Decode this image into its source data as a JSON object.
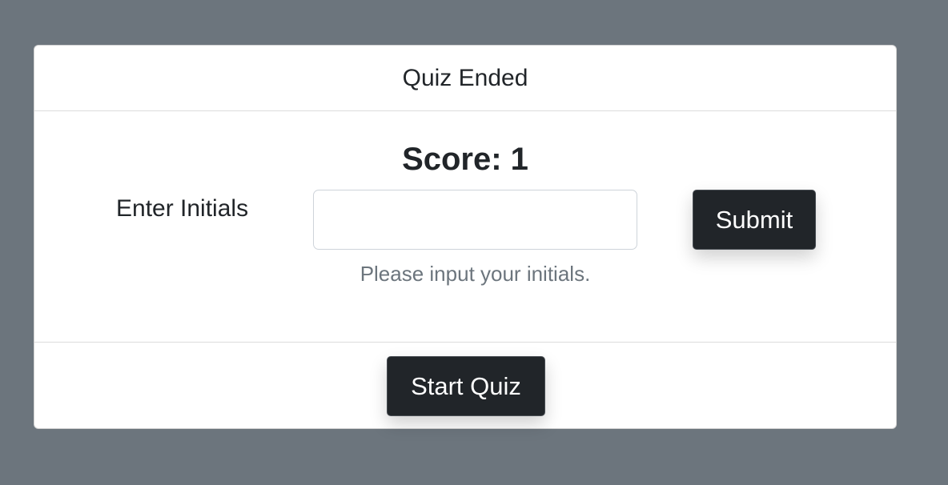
{
  "card": {
    "header_title": "Quiz Ended",
    "score_text": "Score: 1",
    "initials_label": "Enter Initials",
    "initials_input_value": "",
    "initials_input_placeholder": "",
    "help_text": "Please input your initials.",
    "submit_label": "Submit",
    "start_label": "Start Quiz"
  },
  "colors": {
    "background": "#6c757d",
    "card": "#ffffff",
    "button_dark": "#212529",
    "muted_text": "#6c757d"
  }
}
